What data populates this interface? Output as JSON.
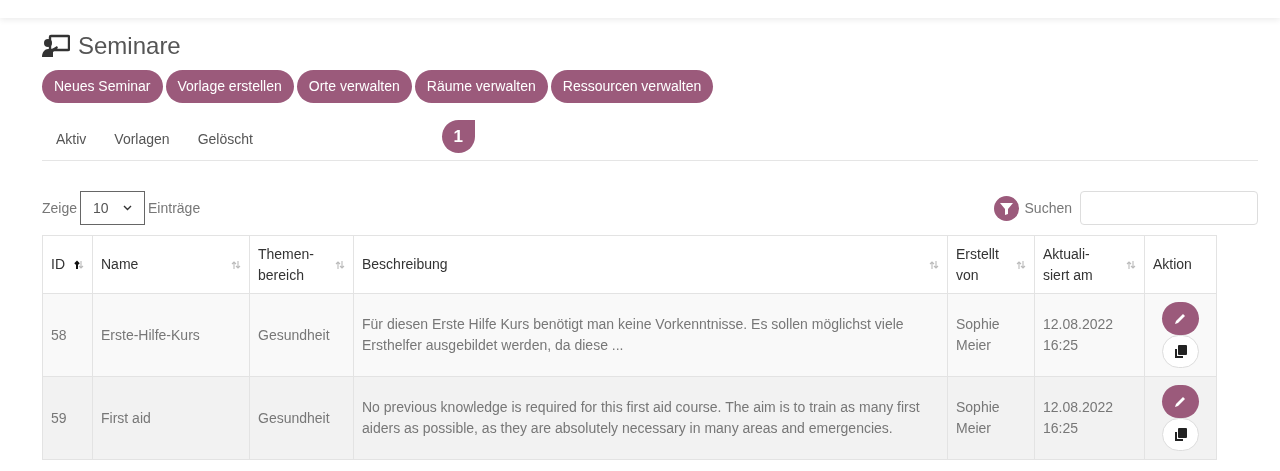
{
  "page": {
    "title": "Seminare"
  },
  "buttons": [
    {
      "label": "Neues Seminar"
    },
    {
      "label": "Vorlage erstellen"
    },
    {
      "label": "Orte verwalten"
    },
    {
      "label": "Räume verwalten",
      "marker": "1"
    },
    {
      "label": "Ressourcen verwalten"
    }
  ],
  "tabs": [
    {
      "label": "Aktiv"
    },
    {
      "label": "Vorlagen"
    },
    {
      "label": "Gelöscht"
    }
  ],
  "length": {
    "before": "Zeige",
    "value": "10",
    "after": "Einträge"
  },
  "search": {
    "label": "Suchen"
  },
  "table": {
    "columns": [
      {
        "label": "ID",
        "sortable": true,
        "sorted": true
      },
      {
        "label": "Name",
        "sortable": true,
        "sorted": false
      },
      {
        "label": "Themen-\nbereich",
        "sortable": true,
        "sorted": false
      },
      {
        "label": "Beschreibung",
        "sortable": true,
        "sorted": false
      },
      {
        "label": "Erstellt\nvon",
        "sortable": true,
        "sorted": false
      },
      {
        "label": "Aktuali-\nsiert am",
        "sortable": true,
        "sorted": false
      },
      {
        "label": "Aktion",
        "sortable": false
      }
    ],
    "rows": [
      {
        "id": "58",
        "name": "Erste-Hilfe-Kurs",
        "topic": "Gesundheit",
        "description": "Für diesen Erste Hilfe Kurs benötigt man keine Vorkenntnisse. Es sollen möglichst viele Ersthelfer ausgebildet werden, da diese ...",
        "author": "Sophie\nMeier",
        "updated": "12.08.2022\n16:25"
      },
      {
        "id": "59",
        "name": "First aid",
        "topic": "Gesundheit",
        "description": "No previous knowledge is required for this first aid course. The aim is to train as many first aiders as possible, as they are absolutely necessary in many areas and emergencies.",
        "author": "Sophie\nMeier",
        "updated": "12.08.2022\n16:25"
      }
    ]
  }
}
